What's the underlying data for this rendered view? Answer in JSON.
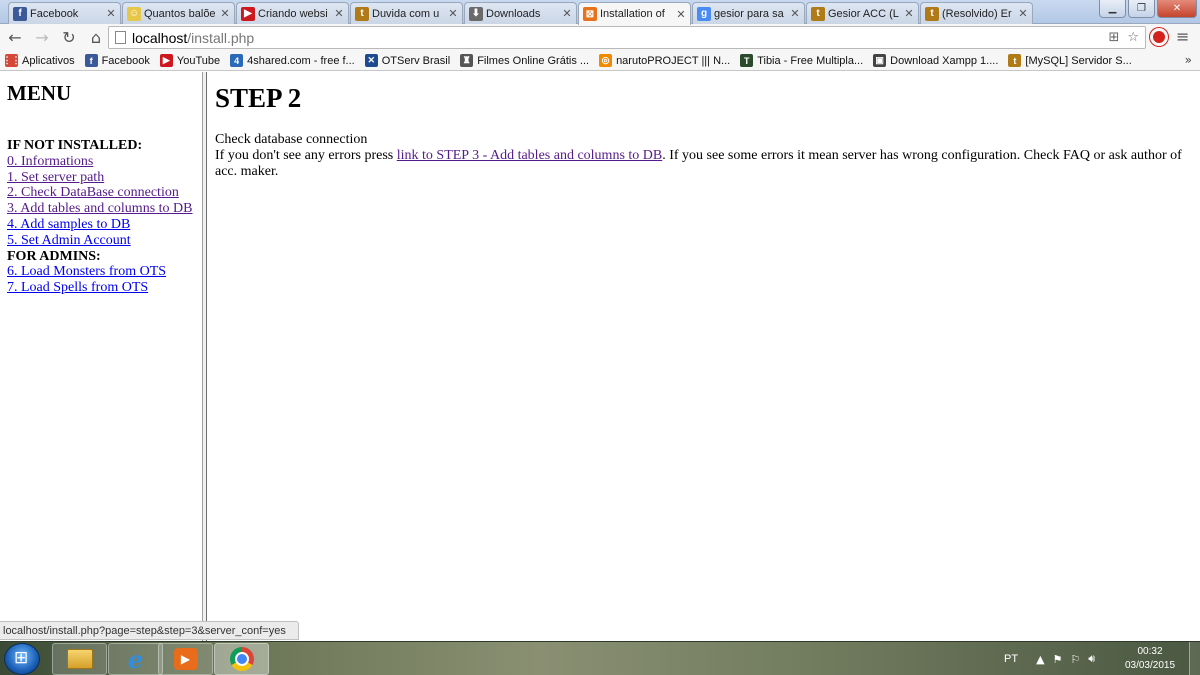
{
  "browser": {
    "tabs": [
      {
        "title": "Facebook",
        "icon": "f",
        "color": "#3b5998",
        "active": false
      },
      {
        "title": "Quantos balõe",
        "icon": "☺",
        "color": "#e6c74a",
        "active": false
      },
      {
        "title": "Criando websi",
        "icon": "▶",
        "color": "#cc181e",
        "active": false
      },
      {
        "title": "Duvida com u",
        "icon": "t",
        "color": "#b07a16",
        "active": false
      },
      {
        "title": "Downloads",
        "icon": "⬇",
        "color": "#6a6a6a",
        "active": false
      },
      {
        "title": "Installation of",
        "icon": "⊠",
        "color": "#e8711a",
        "active": true
      },
      {
        "title": "gesior para sa",
        "icon": "g",
        "color": "#4a8af4",
        "active": false
      },
      {
        "title": "Gesior ACC (L",
        "icon": "t",
        "color": "#b07a16",
        "active": false
      },
      {
        "title": "(Resolvido) Er",
        "icon": "t",
        "color": "#b07a16",
        "active": false
      }
    ],
    "address": {
      "host": "localhost",
      "path": "/install.php"
    },
    "bookmarks": [
      {
        "label": "Aplicativos",
        "icon": "⋮⋮",
        "color": "#d34836"
      },
      {
        "label": "Facebook",
        "icon": "f",
        "color": "#3b5998"
      },
      {
        "label": "YouTube",
        "icon": "▶",
        "color": "#cc181e"
      },
      {
        "label": "4shared.com - free f...",
        "icon": "4",
        "color": "#2a6ab8"
      },
      {
        "label": "OTServ Brasil",
        "icon": "✕",
        "color": "#1e4b8f"
      },
      {
        "label": "Filmes Online Grátis ...",
        "icon": "♜",
        "color": "#555555"
      },
      {
        "label": "narutoPROJECT ||| N...",
        "icon": "◎",
        "color": "#f08a00"
      },
      {
        "label": "Tibia - Free Multipla...",
        "icon": "T",
        "color": "#2b4a2b"
      },
      {
        "label": "Download Xampp 1....",
        "icon": "▣",
        "color": "#444444"
      },
      {
        "label": "[MySQL] Servidor S...",
        "icon": "t",
        "color": "#b07a16"
      }
    ],
    "status_url": "localhost/install.php?page=step&step=3&server_conf=yes"
  },
  "menu": {
    "title": "MENU",
    "sections": [
      {
        "heading": "IF NOT INSTALLED:",
        "links": [
          {
            "label": "0. Informations",
            "visited": true
          },
          {
            "label": "1. Set server path",
            "visited": true
          },
          {
            "label": "2. Check DataBase connection",
            "visited": true
          },
          {
            "label": "3. Add tables and columns to DB",
            "visited": true
          },
          {
            "label": "4. Add samples to DB",
            "visited": false
          },
          {
            "label": "5. Set Admin Account",
            "visited": false
          }
        ]
      },
      {
        "heading": "FOR ADMINS:",
        "links": [
          {
            "label": "6. Load Monsters from OTS",
            "visited": false
          },
          {
            "label": "7. Load Spells from OTS",
            "visited": false
          }
        ]
      }
    ]
  },
  "main": {
    "title": "STEP 2",
    "line1": "Check database connection",
    "line2_before": "If you don't see any errors press ",
    "line2_link": "link to STEP 3 - Add tables and columns to DB",
    "line2_after": ". If you see some errors it mean server has wrong configuration. Check FAQ or ask author of acc. maker."
  },
  "taskbar": {
    "language": "PT",
    "time": "00:32",
    "date": "03/03/2015"
  }
}
